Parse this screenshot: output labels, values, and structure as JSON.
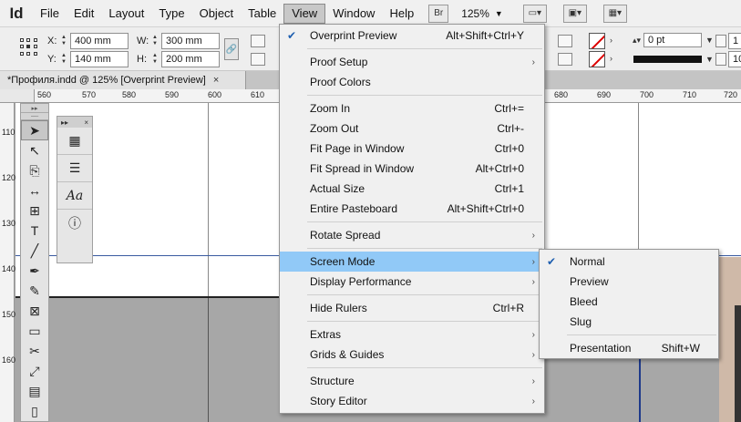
{
  "app": {
    "logo": "Id"
  },
  "menubar": {
    "items": [
      "File",
      "Edit",
      "Layout",
      "Type",
      "Object",
      "Table",
      "View",
      "Window",
      "Help"
    ],
    "bridge_label": "Br",
    "zoom": "125%"
  },
  "control": {
    "x_label": "X:",
    "x_value": "400 mm",
    "y_label": "Y:",
    "y_value": "140 mm",
    "w_label": "W:",
    "w_value": "300 mm",
    "h_label": "H:",
    "h_value": "200 mm",
    "stroke_weight": "0 pt",
    "right_value_1": "1",
    "right_value_2": "10"
  },
  "tab": {
    "title": "*Профиля.indd @ 125% [Overprint Preview]",
    "close": "×"
  },
  "ruler": {
    "top_labels": [
      "560",
      "570",
      "580",
      "590",
      "600",
      "610",
      "680",
      "690",
      "700",
      "710",
      "720"
    ],
    "left_labels": [
      "110",
      "120",
      "130",
      "140",
      "150",
      "160"
    ]
  },
  "view_menu": {
    "items": [
      {
        "label": "Overprint Preview",
        "shortcut": "Alt+Shift+Ctrl+Y",
        "checked": true
      },
      {
        "label": "Proof Setup",
        "submenu": true
      },
      {
        "label": "Proof Colors"
      },
      {
        "label": "Zoom In",
        "shortcut": "Ctrl+="
      },
      {
        "label": "Zoom Out",
        "shortcut": "Ctrl+-"
      },
      {
        "label": "Fit Page in Window",
        "shortcut": "Ctrl+0"
      },
      {
        "label": "Fit Spread in Window",
        "shortcut": "Alt+Ctrl+0"
      },
      {
        "label": "Actual Size",
        "shortcut": "Ctrl+1"
      },
      {
        "label": "Entire Pasteboard",
        "shortcut": "Alt+Shift+Ctrl+0"
      },
      {
        "label": "Rotate Spread",
        "submenu": true
      },
      {
        "label": "Screen Mode",
        "submenu": true,
        "highlighted": true
      },
      {
        "label": "Display Performance",
        "submenu": true
      },
      {
        "label": "Hide Rulers",
        "shortcut": "Ctrl+R"
      },
      {
        "label": "Extras",
        "submenu": true
      },
      {
        "label": "Grids & Guides",
        "submenu": true
      },
      {
        "label": "Structure",
        "submenu": true
      },
      {
        "label": "Story Editor",
        "submenu": true
      }
    ]
  },
  "screen_mode_menu": {
    "items": [
      {
        "label": "Normal",
        "checked": true
      },
      {
        "label": "Preview"
      },
      {
        "label": "Bleed"
      },
      {
        "label": "Slug"
      },
      {
        "label": "Presentation",
        "shortcut": "Shift+W"
      }
    ]
  },
  "colors": {
    "highlight": "#91c9f7",
    "check": "#1e5fb0",
    "guide": "#3a5ba0"
  }
}
